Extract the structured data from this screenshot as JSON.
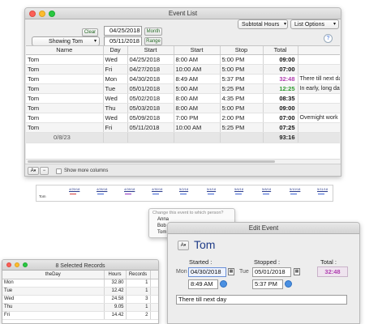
{
  "event_list": {
    "title": "Event List",
    "clear_label": "Clear",
    "start_date": "04/25/2018",
    "end_date": "05/11/2018",
    "month_label": "Month",
    "range_label": "Range",
    "showing": "Showing Tom",
    "subtotal": "Subtotal Hours",
    "list_options": "List Options",
    "help": "?",
    "columns": [
      "Name",
      "Day",
      "Start",
      "Start",
      "Stop",
      "Total"
    ],
    "rows": [
      {
        "name": "Tom",
        "day": "Wed",
        "date": "04/25/2018",
        "start": "8:00 AM",
        "stop": "5:00 PM",
        "total": "09:00",
        "note": "",
        "color": "#111111"
      },
      {
        "name": "Tom",
        "day": "Fri",
        "date": "04/27/2018",
        "start": "10:00 AM",
        "stop": "5:00 PM",
        "total": "07:00",
        "note": "",
        "color": "#111111"
      },
      {
        "name": "Tom",
        "day": "Mon",
        "date": "04/30/2018",
        "start": "8:49 AM",
        "stop": "5:37 PM",
        "total": "32:48",
        "note": "There till next day",
        "color": "#b03fb0"
      },
      {
        "name": "Tom",
        "day": "Tue",
        "date": "05/01/2018",
        "start": "5:00 AM",
        "stop": "5:25 PM",
        "total": "12:25",
        "note": "In early, long day",
        "color": "#2e9a2e"
      },
      {
        "name": "Tom",
        "day": "Wed",
        "date": "05/02/2018",
        "start": "8:00 AM",
        "stop": "4:35 PM",
        "total": "08:35",
        "note": "",
        "color": "#111111"
      },
      {
        "name": "Tom",
        "day": "Thu",
        "date": "05/03/2018",
        "start": "8:00 AM",
        "stop": "5:00 PM",
        "total": "09:00",
        "note": "",
        "color": "#111111"
      },
      {
        "name": "Tom",
        "day": "Wed",
        "date": "05/09/2018",
        "start": "7:00 PM",
        "stop": "2:00 PM",
        "total": "07:00",
        "note": "Overnight work",
        "color": "#111111"
      },
      {
        "name": "Tom",
        "day": "Fri",
        "date": "05/11/2018",
        "start": "10:00 AM",
        "stop": "5:25 PM",
        "total": "07:25",
        "note": "",
        "color": "#111111"
      }
    ],
    "count": "0/8/23",
    "sum_total": "93:16",
    "show_more": "Show more columns",
    "add_label": "A",
    "remove_label": "−"
  },
  "timeline": {
    "row_label": "Tom",
    "ticks": [
      "4/25/18",
      "4/26/18",
      "4/28/18",
      "4/30/18",
      "5/2/18",
      "5/4/18",
      "5/6/18",
      "5/8/18",
      "5/10/18",
      "5/11/18"
    ],
    "bar_colors": [
      "#d33a3a",
      "#3a5fd3",
      "#8f2fbf",
      "#3a5fd3",
      "#3a5fd3",
      "#3a5fd3",
      "#3a5fd3",
      "#3a5fd3",
      "#3a5fd3",
      "#3a5fd3"
    ]
  },
  "person_popup": {
    "hint": "Change this event to which person?",
    "options": [
      "Anna",
      "Bob",
      "Tom"
    ]
  },
  "edit_event": {
    "title": "Edit Event",
    "name": "Tom",
    "name_button": "A",
    "started_label": "Started :",
    "stopped_label": "Stopped :",
    "total_label": "Total :",
    "start_day": "Mon",
    "start_date": "04/30/2018",
    "stop_day": "Tue",
    "stop_date": "05/01/2018",
    "start_time": "8:49 AM",
    "stop_time": "5:37 PM",
    "total": "32:48",
    "note": "There till next day"
  },
  "selected_records": {
    "title": "8 Selected Records",
    "columns": [
      "theDay",
      "Hours",
      "Records"
    ],
    "rows": [
      {
        "day": "Mon",
        "hours": "32.80",
        "records": "1"
      },
      {
        "day": "Tue",
        "hours": "12.42",
        "records": "1"
      },
      {
        "day": "Wed",
        "hours": "24.58",
        "records": "3"
      },
      {
        "day": "Thu",
        "hours": "9.05",
        "records": "1"
      },
      {
        "day": "Fri",
        "hours": "14.42",
        "records": "2"
      }
    ]
  }
}
